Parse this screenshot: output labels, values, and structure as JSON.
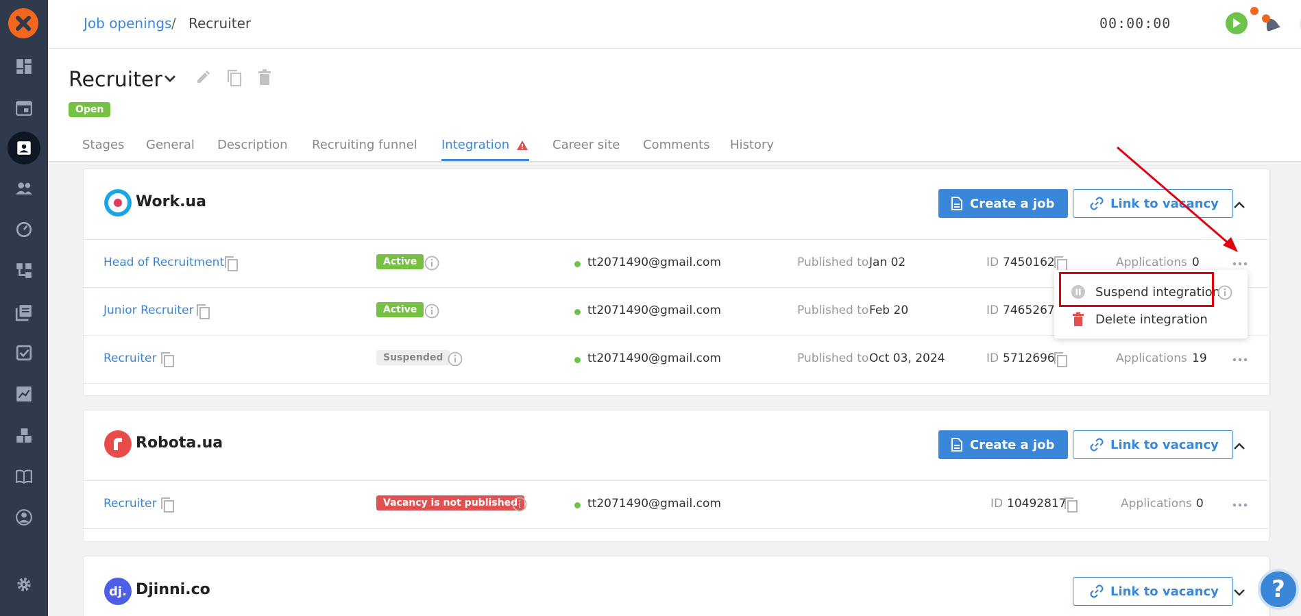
{
  "breadcrumb": {
    "parent": "Job openings",
    "separator": "/",
    "current": "Recruiter"
  },
  "timer": "00:00:00",
  "header": {
    "title": "Recruiter",
    "status": "Open",
    "tabs": [
      "Stages",
      "General",
      "Description",
      "Recruiting funnel",
      "Integration",
      "Career site",
      "Comments",
      "History"
    ],
    "active_tab": "Integration"
  },
  "integrations": [
    {
      "name": "Work.ua",
      "create_label": "Create a job",
      "link_label": "Link to vacancy",
      "rows": [
        {
          "vacancy": "Head of Recruitment",
          "status": "Active",
          "email": "tt2071490@gmail.com",
          "published_label": "Published to",
          "published": "Jan 02",
          "id_label": "ID",
          "id": "7450162",
          "apps_label": "Applications",
          "apps": "0"
        },
        {
          "vacancy": "Junior Recruiter",
          "status": "Active",
          "email": "tt2071490@gmail.com",
          "published_label": "Published to",
          "published": "Feb 20",
          "id_label": "ID",
          "id": "7465267",
          "apps_label": "",
          "apps": ""
        },
        {
          "vacancy": "Recruiter",
          "status": "Suspended",
          "email": "tt2071490@gmail.com",
          "published_label": "Published to",
          "published": "Oct 03, 2024",
          "id_label": "ID",
          "id": "5712696",
          "apps_label": "Applications",
          "apps": "19"
        }
      ]
    },
    {
      "name": "Robota.ua",
      "create_label": "Create a job",
      "link_label": "Link to vacancy",
      "rows": [
        {
          "vacancy": "Recruiter",
          "status": "Vacancy is not published",
          "email": "tt2071490@gmail.com",
          "id_label": "ID",
          "id": "10492817",
          "apps_label": "Applications",
          "apps": "0"
        }
      ]
    },
    {
      "name": "Djinni.co",
      "link_label": "Link to vacancy"
    }
  ],
  "menu": {
    "suspend": "Suspend integration",
    "delete": "Delete integration"
  },
  "help_label": "?",
  "colors": {
    "accent": "#3a87d9",
    "brand_orange": "#f3661f",
    "sidebar": "#2f3a4c",
    "success": "#76c043",
    "danger": "#e05151",
    "annotation": "#e1000f"
  }
}
